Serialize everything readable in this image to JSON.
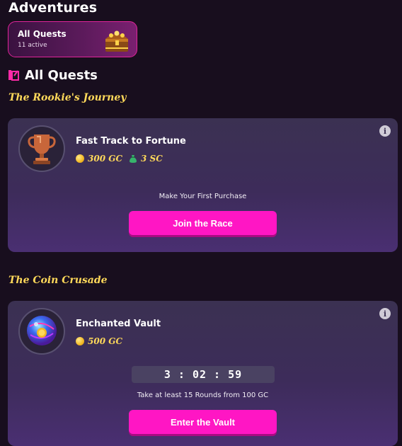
{
  "header": {
    "title": "Adventures"
  },
  "quest_tab": {
    "title": "All Quests",
    "subtitle": "11 active"
  },
  "section": {
    "label": "All Quests"
  },
  "groups": [
    {
      "title": "The Rookie's Journey",
      "quest": {
        "name": "Fast Track to Fortune",
        "rewards": [
          {
            "icon": "coin-icon",
            "value": "300 GC"
          },
          {
            "icon": "money-bag-icon",
            "value": "3 SC"
          }
        ],
        "task": "Make Your First Purchase",
        "button": "Join the Race",
        "medal_icon": "trophy-icon"
      }
    },
    {
      "title": "The Coin Crusade",
      "quest": {
        "name": "Enchanted Vault",
        "rewards": [
          {
            "icon": "coin-icon",
            "value": "500 GC"
          }
        ],
        "timer": "3 : 02 : 59",
        "task": "Take at least 15 Rounds from 100 GC",
        "button": "Enter the Vault",
        "medal_icon": "crystal-orb-icon"
      }
    }
  ],
  "colors": {
    "accent": "#ff16c4",
    "gold": "#ffd95a",
    "background": "#180e1e",
    "card": "#3b3152"
  }
}
